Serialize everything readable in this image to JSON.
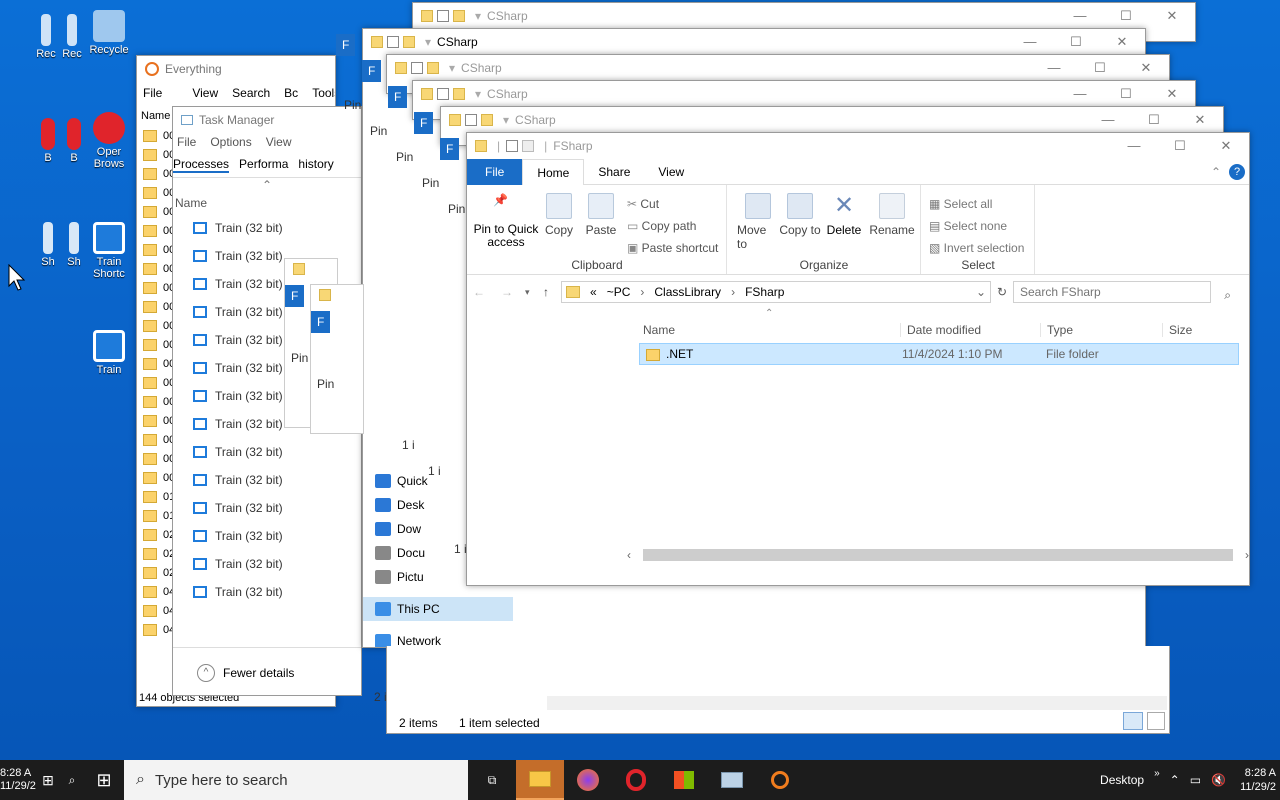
{
  "desktop": {
    "icons": [
      {
        "label": "Rec",
        "name": "recycle-icon-1"
      },
      {
        "label": "Rec",
        "name": "recycle-icon-2"
      },
      {
        "label": "Recycle",
        "name": "recycle-bin-icon"
      },
      {
        "label": "B",
        "name": "browser-1-icon"
      },
      {
        "label": "B",
        "name": "browser-2-icon"
      },
      {
        "label": "Oper Brows",
        "name": "opera-browser-icon"
      },
      {
        "label": "Sh",
        "name": "shortcut-1-icon"
      },
      {
        "label": "Sh",
        "name": "shortcut-2-icon"
      },
      {
        "label": "Train Shortc",
        "name": "train-shortcut-icon"
      },
      {
        "label": "Train",
        "name": "train-icon"
      }
    ]
  },
  "everything": {
    "title": "Everything",
    "menu": [
      "File",
      "View",
      "Search",
      "Bc",
      "Tools"
    ],
    "col_name": "Name",
    "rows": [
      "00C",
      "00C",
      "00C",
      "00C",
      "00C",
      "001",
      "001",
      "001",
      "001",
      "001",
      "001",
      "001",
      "001",
      "001",
      "001",
      "001",
      "002",
      "002",
      "002",
      "017",
      "01a",
      "028",
      "029",
      "029",
      "040",
      "0407",
      "0407"
    ],
    "status": "144 objects selected"
  },
  "task_manager": {
    "title": "Task Manager",
    "menu": [
      "File",
      "Options",
      "View"
    ],
    "tabs": [
      "Processes",
      "Performa",
      "history"
    ],
    "col_name": "Name",
    "process_label": "Train (32 bit)",
    "process_count": 14,
    "fewer_details": "Fewer details"
  },
  "behind_windows": {
    "csharp_title": "CSharp",
    "pin_label": "Pin",
    "f_label": "F",
    "one_item": "1 i",
    "two_items": "2 i"
  },
  "explorer_back": {
    "nav": [
      {
        "label": "Quick",
        "name": "nav-quick-access",
        "color": "#2b78d6"
      },
      {
        "label": "Desk",
        "name": "nav-desktop",
        "color": "#2b78d6"
      },
      {
        "label": "Dow",
        "name": "nav-downloads",
        "color": "#2b78d6"
      },
      {
        "label": "Docu",
        "name": "nav-documents",
        "color": "#6a6a6a"
      },
      {
        "label": "Pictu",
        "name": "nav-pictures",
        "color": "#6a6a6a"
      }
    ],
    "this_pc": "This PC",
    "network": "Network",
    "status_items": "2 items",
    "status_selected": "1 item selected"
  },
  "fsharp": {
    "title": "FSharp",
    "tabs": [
      "File",
      "Home",
      "Share",
      "View"
    ],
    "clipboard": {
      "pin": "Pin to Quick access",
      "copy": "Copy",
      "paste": "Paste",
      "cut": "Cut",
      "copy_path": "Copy path",
      "paste_shortcut": "Paste shortcut",
      "group": "Clipboard"
    },
    "organize": {
      "move_to": "Move to",
      "copy_to": "Copy to",
      "delete": "Delete",
      "rename": "Rename",
      "group": "Organize"
    },
    "select": {
      "select_all": "Select all",
      "select_none": "Select none",
      "invert": "Invert selection",
      "group": "Select"
    },
    "address": [
      "«",
      "~PC",
      "ClassLibrary",
      "FSharp"
    ],
    "search_placeholder": "Search FSharp",
    "columns": [
      "Name",
      "Date modified",
      "Type",
      "Size"
    ],
    "files": [
      {
        "name": ".NET",
        "date": "11/4/2024 1:10 PM",
        "type": "File folder",
        "size": ""
      }
    ]
  },
  "taskbar": {
    "left_time": "8:28 A",
    "left_date": "11/29/2",
    "search_placeholder": "Type here to search",
    "desktop_label": "Desktop",
    "clock_time": "8:28 A",
    "clock_date": "11/29/2"
  }
}
